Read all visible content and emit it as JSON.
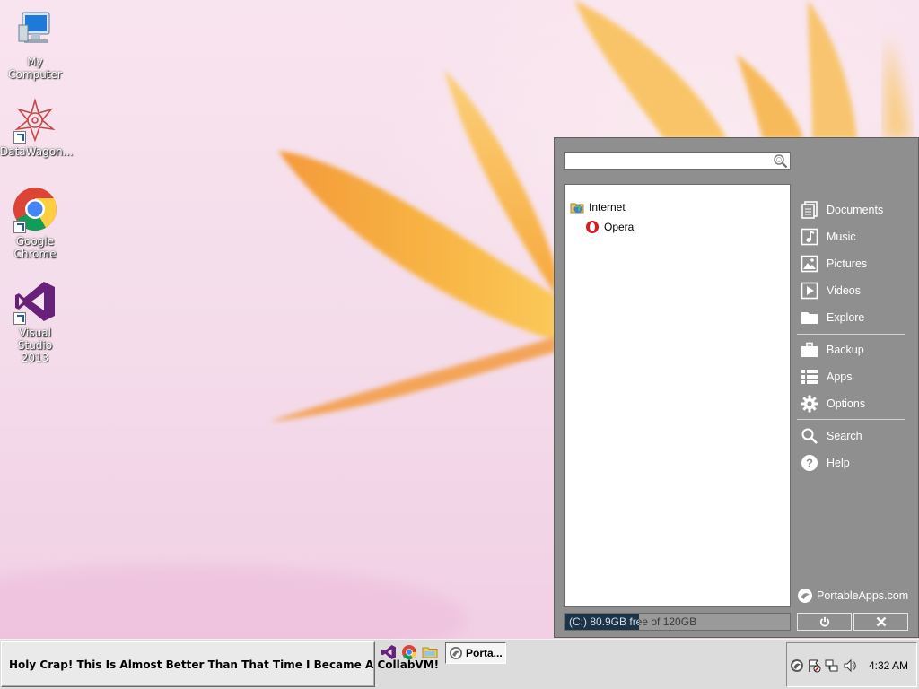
{
  "desktop": {
    "icons": [
      {
        "label": "My Computer",
        "icon": "computer-icon"
      },
      {
        "label": "DataWagon...",
        "icon": "datawagon-icon"
      },
      {
        "label": "Google Chrome",
        "icon": "chrome-icon"
      },
      {
        "label": "Visual Studio 2013",
        "icon": "visual-studio-icon"
      }
    ]
  },
  "portableapps": {
    "search": {
      "value": "",
      "placeholder": ""
    },
    "tree": [
      {
        "label": "Internet",
        "icon": "internet-folder-icon"
      },
      {
        "label": "Opera",
        "icon": "opera-icon"
      }
    ],
    "sidebar": [
      {
        "label": "Documents",
        "icon": "documents-icon"
      },
      {
        "label": "Music",
        "icon": "music-icon"
      },
      {
        "label": "Pictures",
        "icon": "pictures-icon"
      },
      {
        "label": "Videos",
        "icon": "videos-icon"
      },
      {
        "label": "Explore",
        "icon": "folder-icon"
      },
      {
        "label": "Backup",
        "icon": "briefcase-icon"
      },
      {
        "label": "Apps",
        "icon": "apps-list-icon"
      },
      {
        "label": "Options",
        "icon": "gear-icon"
      },
      {
        "label": "Search",
        "icon": "search-icon"
      },
      {
        "label": "Help",
        "icon": "help-icon"
      }
    ],
    "brand": "PortableApps.com",
    "status": "(C:) 80.9GB free of 120GB",
    "disk_used_fraction": 0.33,
    "power_icon": "power-icon",
    "close_icon": "close-icon"
  },
  "taskbar": {
    "start_label": "Holy Crap! This Is Almost Better Than That Time I Became A CollabVM!",
    "quick_launch": [
      "visual-studio-icon",
      "chrome-icon",
      "explorer-folder-icon"
    ],
    "tasks": [
      {
        "label": "Porta...",
        "icon": "portableapps-icon"
      }
    ],
    "tray_icons": [
      "portableapps-tray-icon",
      "action-center-flag-icon",
      "network-icon",
      "volume-icon"
    ],
    "clock": "4:32 AM"
  },
  "colors": {
    "panel_bg": "#8f8f8f",
    "accent_blue": "#1c5db0",
    "petal_orange": "#f6ac3c"
  }
}
